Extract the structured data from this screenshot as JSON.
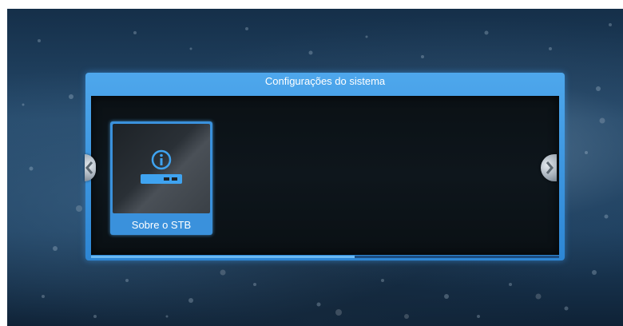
{
  "dialog": {
    "title": "Configurações do sistema"
  },
  "items": [
    {
      "label": "Sobre o STB",
      "icon": "info-set-top-box-icon",
      "selected": true
    }
  ],
  "navigation": {
    "left_icon": "arrow-left-icon",
    "right_icon": "arrow-right-icon"
  },
  "colors": {
    "accent": "#3a91dc",
    "panel_body": "#0b1115",
    "text": "#ffffff"
  }
}
